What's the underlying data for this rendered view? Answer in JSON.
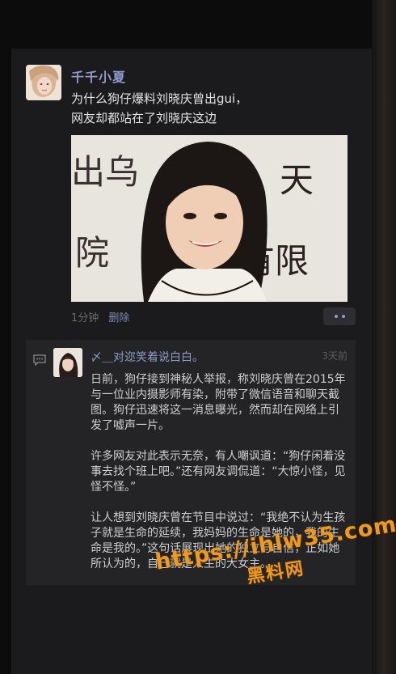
{
  "post": {
    "username": "千千小夏",
    "text_line1": "为什么狗仔爆料刘晓庆曾出gui，",
    "text_line2": "网友却都站在了刘晓庆这边",
    "time": "1分钟",
    "delete_label": "删除",
    "image_sign_text": "出乌 天 院 有限"
  },
  "comment": {
    "username": "〆＿对迩笑着说白白。",
    "time": "3天前",
    "paragraphs": [
      "日前，狗仔接到神秘人举报，称刘晓庆曾在2015年与一位业内摄影师有染，附带了微信语音和聊天截图。狗仔迅速将这一消息曝光，然而却在网络上引发了嘘声一片。",
      "许多网友对此表示无奈，有人嘲讽道：“狗仔闲着没事去找个班上吧。”还有网友调侃道：“大惊小怪，见怪不怪。”",
      "让人想到刘晓庆曾在节目中说过：“我绝不认为生孩子就是生命的延续，我妈妈的生命是她的，我的生命是我的。”这句话展现出她的独立与自信，正如她所认为的，自己就是人生的大女主。"
    ]
  },
  "watermark": {
    "url": "https://ihlw35.com",
    "name": "黑料网"
  },
  "colors": {
    "link": "#8d9bc6",
    "watermark": "#ee9a1c"
  },
  "icons": {
    "more": "more-dots-icon",
    "comment": "comment-icon"
  }
}
